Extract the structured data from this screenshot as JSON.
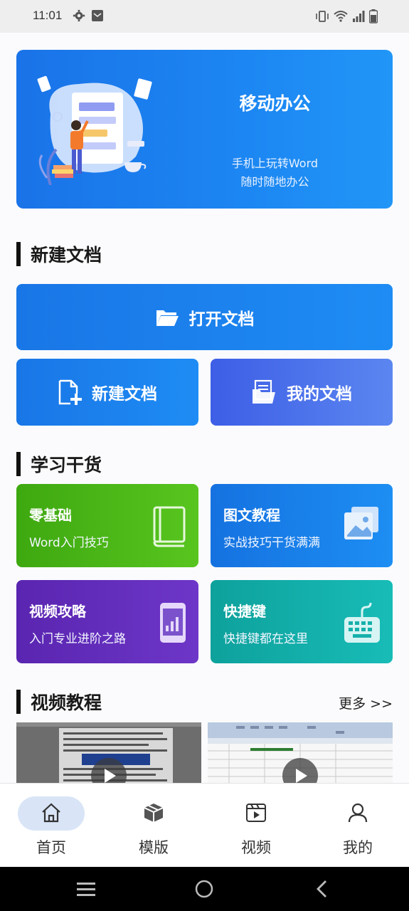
{
  "status_bar": {
    "time": "11:01"
  },
  "banner": {
    "title": "移动办公",
    "subtitle_line1": "手机上玩转Word",
    "subtitle_line2": "随时随地办公"
  },
  "sections": {
    "new_doc": "新建文档",
    "learning": "学习干货",
    "video": "视频教程"
  },
  "buttons": {
    "open_doc": "打开文档",
    "new_doc": "新建文档",
    "my_docs": "我的文档"
  },
  "cards": [
    {
      "title": "零基础",
      "subtitle": "Word入门技巧",
      "color": "#47b214"
    },
    {
      "title": "图文教程",
      "subtitle": "实战技巧干货满满",
      "color": "#1a7ee8"
    },
    {
      "title": "视频攻略",
      "subtitle": "入门专业进阶之路",
      "color": "#5a2bb5"
    },
    {
      "title": "快捷键",
      "subtitle": "快捷键都在这里",
      "color": "#12a8a4"
    }
  ],
  "video_more": "更多 >>",
  "tabs": [
    {
      "label": "首页",
      "icon": "home-icon",
      "active": true
    },
    {
      "label": "模版",
      "icon": "box-icon",
      "active": false
    },
    {
      "label": "视频",
      "icon": "video-icon",
      "active": false
    },
    {
      "label": "我的",
      "icon": "user-icon",
      "active": false
    }
  ],
  "colors": {
    "accent": "#1a73e8",
    "active_tab_bg": "#d9e5f7"
  }
}
